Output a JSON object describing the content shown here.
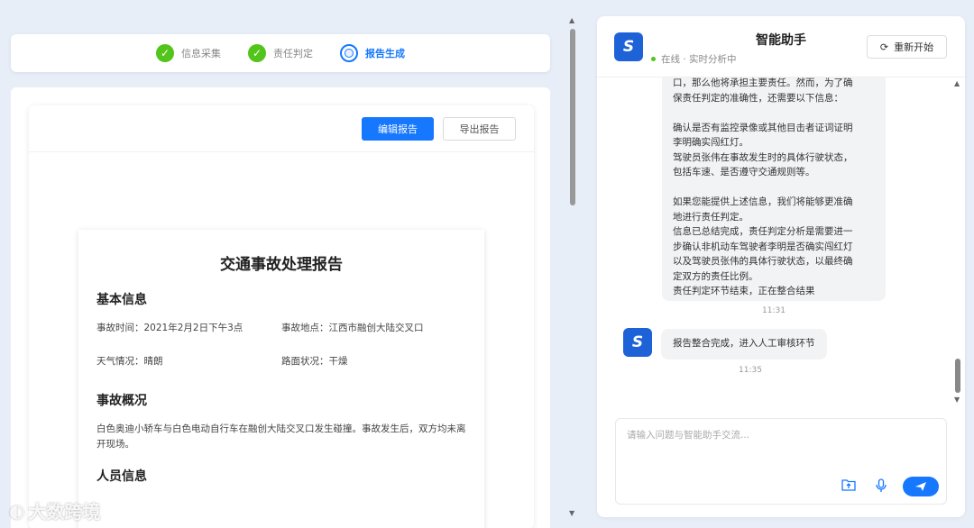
{
  "steps": [
    {
      "label": "信息采集",
      "state": "done"
    },
    {
      "label": "责任判定",
      "state": "done"
    },
    {
      "label": "报告生成",
      "state": "active"
    }
  ],
  "report_toolbar": {
    "edit_label": "编辑报告",
    "export_label": "导出报告"
  },
  "report": {
    "title": "交通事故处理报告",
    "basic_title": "基本信息",
    "time": "事故时间：2021年2月2日下午3点",
    "location": "事故地点：江西市融创大陆交叉口",
    "weather": "天气情况：晴朗",
    "road": "路面状况：干燥",
    "overview_title": "事故概况",
    "overview": "白色奥迪小轿车与白色电动自行车在融创大陆交叉口发生碰撞。事故发生后，双方均未离开现场。",
    "people_title": "人员信息"
  },
  "chat": {
    "title": "智能助手",
    "status": "在线 · 实时分析中",
    "restart_label": "重新开始",
    "logo_glyph": "S",
    "messages": [
      {
        "lines": [
          "口，那么他将承担主要责任。然而，为了确",
          "保责任判定的准确性，还需要以下信息：",
          "",
          "确认是否有监控录像或其他目击者证词证明",
          "李明确实闯红灯。",
          "驾驶员张伟在事故发生时的具体行驶状态，",
          "包括车速、是否遵守交通规则等。",
          "",
          "如果您能提供上述信息，我们将能够更准确",
          "地进行责任判定。",
          "信息已总结完成，责任判定分析是需要进一",
          "步确认非机动车驾驶者李明是否确实闯红灯",
          "以及驾驶员张伟的具体行驶状态，以最终确",
          "定双方的责任比例。",
          "责任判定环节结束，正在整合结果"
        ],
        "time": "11:31"
      },
      {
        "text": "报告整合完成，进入人工审核环节",
        "time": "11:35"
      }
    ],
    "input_placeholder": "请输入问题与智能助手交流..."
  },
  "watermark": "大数跨境",
  "colors": {
    "primary": "#1677ff",
    "success": "#52c41a",
    "logo": "#1e62d8"
  }
}
